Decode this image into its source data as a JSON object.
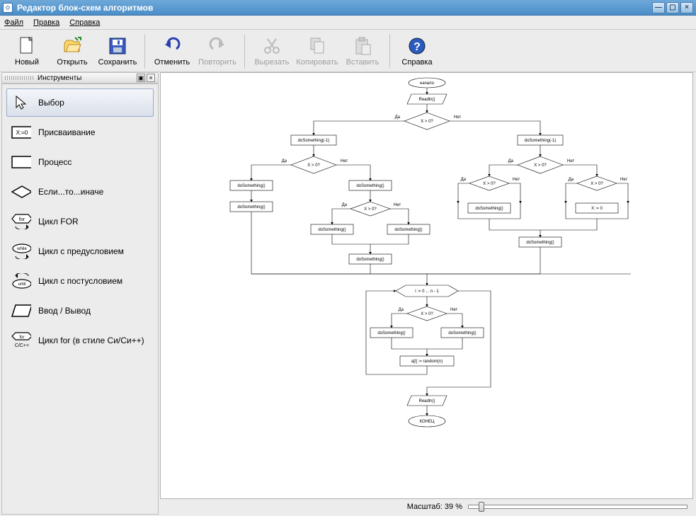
{
  "window": {
    "title": "Редактор блок-схем алгоритмов"
  },
  "menu": {
    "file": "Файл",
    "edit": "Правка",
    "help": "Справка"
  },
  "toolbar": {
    "new": "Новый",
    "open": "Открыть",
    "save": "Сохранить",
    "undo": "Отменить",
    "redo": "Повторить",
    "cut": "Вырезать",
    "copy": "Копировать",
    "paste": "Вставить",
    "help": "Справка"
  },
  "tools_panel": {
    "title": "Инструменты",
    "items": [
      {
        "label": "Выбор"
      },
      {
        "label": "Присваивание"
      },
      {
        "label": "Процесс"
      },
      {
        "label": "Если...то...иначе"
      },
      {
        "label": "Цикл FOR"
      },
      {
        "label": "Цикл с предусловием"
      },
      {
        "label": "Цикл с постусловием"
      },
      {
        "label": "Ввод / Вывод"
      },
      {
        "label": "Цикл for (в стиле Си/Си++)"
      }
    ]
  },
  "status": {
    "zoom_label": "Масштаб: 39 %"
  },
  "diagram": {
    "start": "начало",
    "end": "КОНЕЦ",
    "io": "Readln()",
    "cond": "X > 0?",
    "yes": "Да",
    "no": "Нет",
    "proc_do": "doSomething()",
    "proc_do_neg1": "doSomething(-1)",
    "proc_assign": "X := 0",
    "proc_arr": "a[i] := random(n)",
    "for_loop": "i := 0 ... n - 1"
  }
}
